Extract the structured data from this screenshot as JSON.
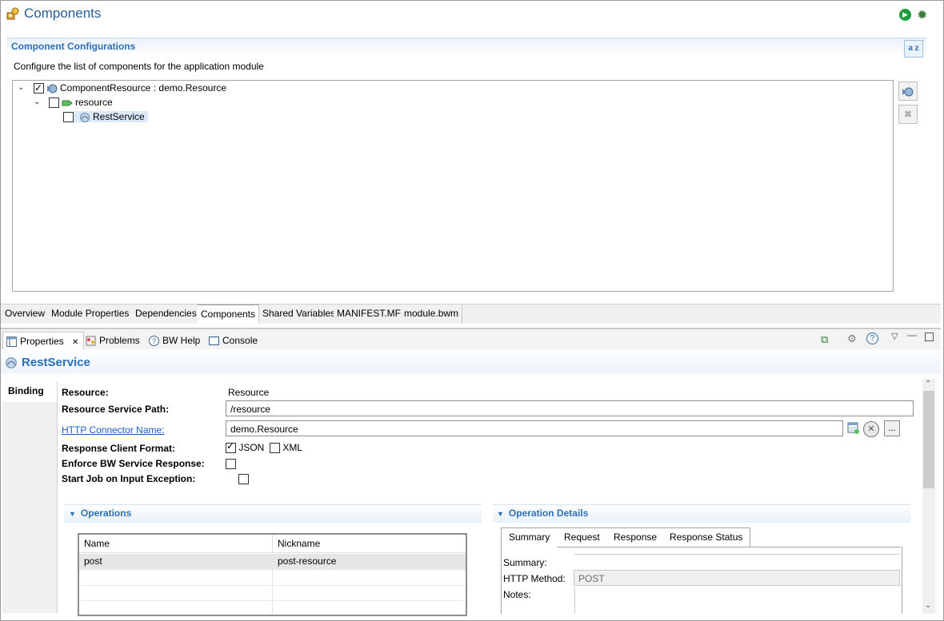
{
  "editor": {
    "title": "Components",
    "section_title": "Component Configurations",
    "section_description": "Configure the list of components for the application module",
    "sort_label": "a z",
    "tree": [
      {
        "label": "ComponentResource : demo.Resource",
        "checked": true
      },
      {
        "label": "resource",
        "checked": false
      },
      {
        "label": "RestService",
        "checked": false,
        "selected": true
      }
    ],
    "tabs": [
      "Overview",
      "Module Properties",
      "Dependencies",
      "Components",
      "Shared Variables",
      "MANIFEST.MF",
      "module.bwm"
    ],
    "active_tab": "Components"
  },
  "views": {
    "tabs": [
      {
        "label": "Properties",
        "icon": "properties-icon"
      },
      {
        "label": "Problems",
        "icon": "problems-icon"
      },
      {
        "label": "BW Help",
        "icon": "help-icon"
      },
      {
        "label": "Console",
        "icon": "console-icon"
      }
    ],
    "active_tab": "Properties"
  },
  "properties": {
    "title": "RestService",
    "side_tab": "Binding",
    "resource_label": "Resource:",
    "resource_value": "Resource",
    "service_path_label": "Resource Service Path:",
    "service_path_value": "/resource",
    "connector_label": "HTTP Connector Name:",
    "connector_value": "demo.Resource",
    "response_format_label": "Response Client Format:",
    "json_label": "JSON",
    "json_checked": true,
    "xml_label": "XML",
    "xml_checked": false,
    "enforce_label": "Enforce BW Service Response:",
    "start_job_label": "Start Job on Input Exception:",
    "browse_label": "...",
    "operations": {
      "title": "Operations",
      "columns": [
        "Name",
        "Nickname"
      ],
      "rows": [
        [
          "post",
          "post-resource"
        ]
      ]
    },
    "operation_details": {
      "title": "Operation Details",
      "tabs": [
        "Summary",
        "Request",
        "Response",
        "Response Status"
      ],
      "active_tab": "Summary",
      "summary_label": "Summary:",
      "method_label": "HTTP Method:",
      "method_value": "POST",
      "notes_label": "Notes:"
    }
  },
  "colors": {
    "accent": "#2a6fb8",
    "title": "#2a5d96"
  }
}
